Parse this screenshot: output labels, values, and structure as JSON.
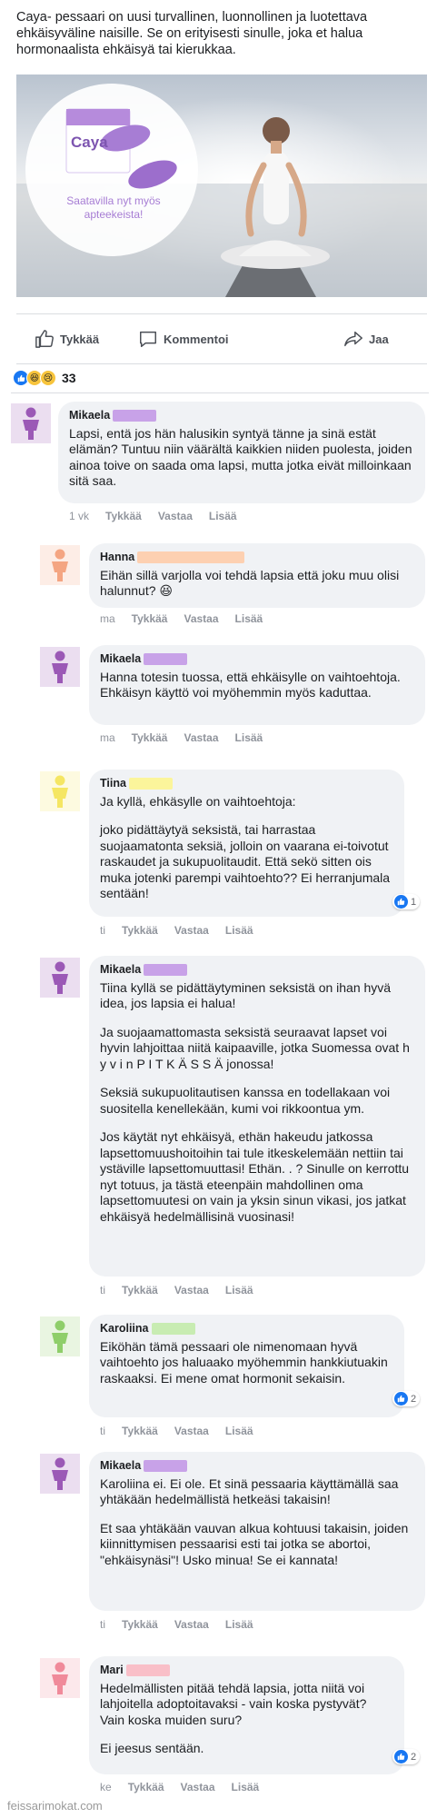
{
  "post": {
    "text": "Caya- pessaari on uusi turvallinen, luonnollinen ja luotettava ehkäisyväline naisille. Se on erityisesti sinulle, joka et halua hormonaalista ehkäisyä tai kierukkaa.",
    "image": {
      "brand": "Caya",
      "caption": "Saatavilla nyt myös apteekeista!"
    }
  },
  "actions": {
    "like": "Tykkää",
    "comment": "Kommentoi",
    "share": "Jaa"
  },
  "reactions": {
    "count": "33"
  },
  "comment_actions": {
    "like": "Tykkää",
    "reply": "Vastaa",
    "more": "Lisää"
  },
  "colors": {
    "accent": "#1877f2",
    "bubble": "#f0f2f5"
  },
  "comments": [
    {
      "name": "Mikaela",
      "avatar_color": "#9b59b6",
      "redact_color": "#c8a2e8",
      "paragraphs": [
        "Lapsi, entä jos hän halusikin syntyä tänne ja sinä estät elämän? Tuntuu niin väärältä kaikkien niiden puolesta, joiden ainoa toive on saada oma lapsi, mutta jotka eivät milloinkaan sitä saa."
      ],
      "time": "1 vk",
      "likes": ""
    },
    {
      "name": "Hanna",
      "avatar_color": "#f4a582",
      "redact_color": "#fdd0b1",
      "paragraphs": [
        "Eihän sillä varjolla voi tehdä lapsia että joku muu olisi halunnut? 😆"
      ],
      "time": "ma",
      "likes": ""
    },
    {
      "name": "Mikaela",
      "avatar_color": "#9b59b6",
      "redact_color": "#c8a2e8",
      "paragraphs": [
        "Hanna totesin tuossa, että ehkäisylle on vaihtoehtoja. Ehkäisyn käyttö voi myöhemmin myös kaduttaa."
      ],
      "time": "ma",
      "likes": ""
    },
    {
      "name": "Tiina",
      "avatar_color": "#f5e663",
      "redact_color": "#fbf59b",
      "paragraphs": [
        "Ja kyllä, ehkäsylle on vaihtoehtoja:",
        "joko pidättäytyä seksistä, tai harrastaa suojaamatonta seksiä, jolloin on vaarana ei-toivotut raskaudet ja sukupuolitaudit. Että sekö sitten ois muka jotenki parempi vaihtoehto?? Ei herranjumala sentään!"
      ],
      "time": "ti",
      "likes": "1"
    },
    {
      "name": "Mikaela",
      "avatar_color": "#9b59b6",
      "redact_color": "#c8a2e8",
      "paragraphs": [
        "Tiina kyllä se pidättäytyminen seksistä on ihan hyvä idea, jos lapsia ei halua!",
        "Ja suojaamattomasta seksistä seuraavat lapset voi hyvin lahjoittaa niitä kaipaaville, jotka Suomessa ovat h y v i n P I T K Ä S S Ä jonossa!",
        "Seksiä sukupuolitautisen kanssa en todellakaan voi suositella kenellekään, kumi voi rikkoontua ym.",
        "Jos käytät nyt ehkäisyä, ethän hakeudu jatkossa lapsettomuushoitoihin tai tule itkeskelemään nettiin tai ystäville lapsettomuuttasi! Ethän. . ? Sinulle on kerrottu nyt totuus, ja tästä eteenpäin mahdollinen oma lapsettomuutesi on vain ja yksin sinun vikasi, jos jatkat ehkäisyä hedelmällisinä vuosinasi!"
      ],
      "time": "ti",
      "likes": ""
    },
    {
      "name": "Karoliina",
      "avatar_color": "#8fce6a",
      "redact_color": "#c8ecb2",
      "paragraphs": [
        "Eiköhän tämä pessaari ole nimenomaan hyvä vaihtoehto jos haluaako myöhemmin hankkiutuakin raskaaksi. Ei mene omat hormonit sekaisin."
      ],
      "time": "ti",
      "likes": "2"
    },
    {
      "name": "Mikaela",
      "avatar_color": "#9b59b6",
      "redact_color": "#c8a2e8",
      "paragraphs": [
        "Karoliina ei. Ei ole. Et sinä pessaaria käyttämällä saa yhtäkään hedelmällistä hetkeäsi takaisin!",
        "Et saa yhtäkään vauvan alkua kohtuusi takaisin, joiden kiinnittymisen pessaarisi esti tai jotka se abortoi, \"ehkäisynäsi\"! Usko minua! Se ei kannata!"
      ],
      "time": "ti",
      "likes": ""
    },
    {
      "name": "Mari",
      "avatar_color": "#f08a9a",
      "redact_color": "#f9bfc8",
      "paragraphs": [
        "Hedelmällisten pitää tehdä lapsia, jotta niitä voi lahjoitella adoptoitavaksi - vain koska pystyvät? Vain koska muiden suru?",
        "Ei jeesus sentään."
      ],
      "time": "ke",
      "likes": "2"
    }
  ],
  "watermark": "feissarimokat.com"
}
